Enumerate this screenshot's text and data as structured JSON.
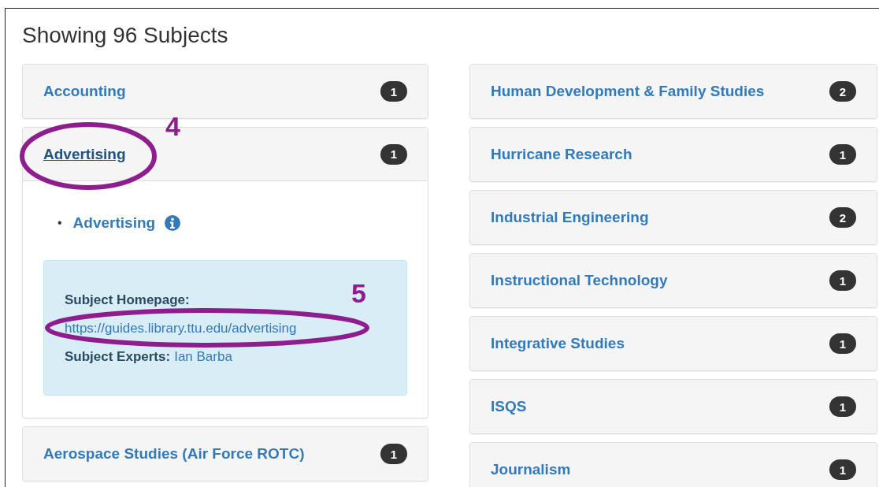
{
  "title": "Showing 96 Subjects",
  "columns": [
    {
      "subjects": [
        {
          "name": "Accounting",
          "count": "1",
          "expanded": false
        },
        {
          "name": "Advertising",
          "count": "1",
          "expanded": true,
          "guides": [
            {
              "bullet": "•",
              "name": "Advertising"
            }
          ],
          "homepage_label": "Subject Homepage:",
          "homepage_url": "https://guides.library.ttu.edu/advertising",
          "experts_label": "Subject Experts:",
          "experts": "Ian Barba"
        },
        {
          "name": "Aerospace Studies (Air Force ROTC)",
          "count": "1",
          "expanded": false
        }
      ]
    },
    {
      "subjects": [
        {
          "name": "Human Development & Family Studies",
          "count": "2",
          "expanded": false
        },
        {
          "name": "Hurricane Research",
          "count": "1",
          "expanded": false
        },
        {
          "name": "Industrial Engineering",
          "count": "2",
          "expanded": false
        },
        {
          "name": "Instructional Technology",
          "count": "1",
          "expanded": false
        },
        {
          "name": "Integrative Studies",
          "count": "1",
          "expanded": false
        },
        {
          "name": "ISQS",
          "count": "1",
          "expanded": false
        },
        {
          "name": "Journalism",
          "count": "1",
          "expanded": false
        }
      ]
    }
  ],
  "annotations": [
    {
      "number": "4"
    },
    {
      "number": "5"
    }
  ]
}
